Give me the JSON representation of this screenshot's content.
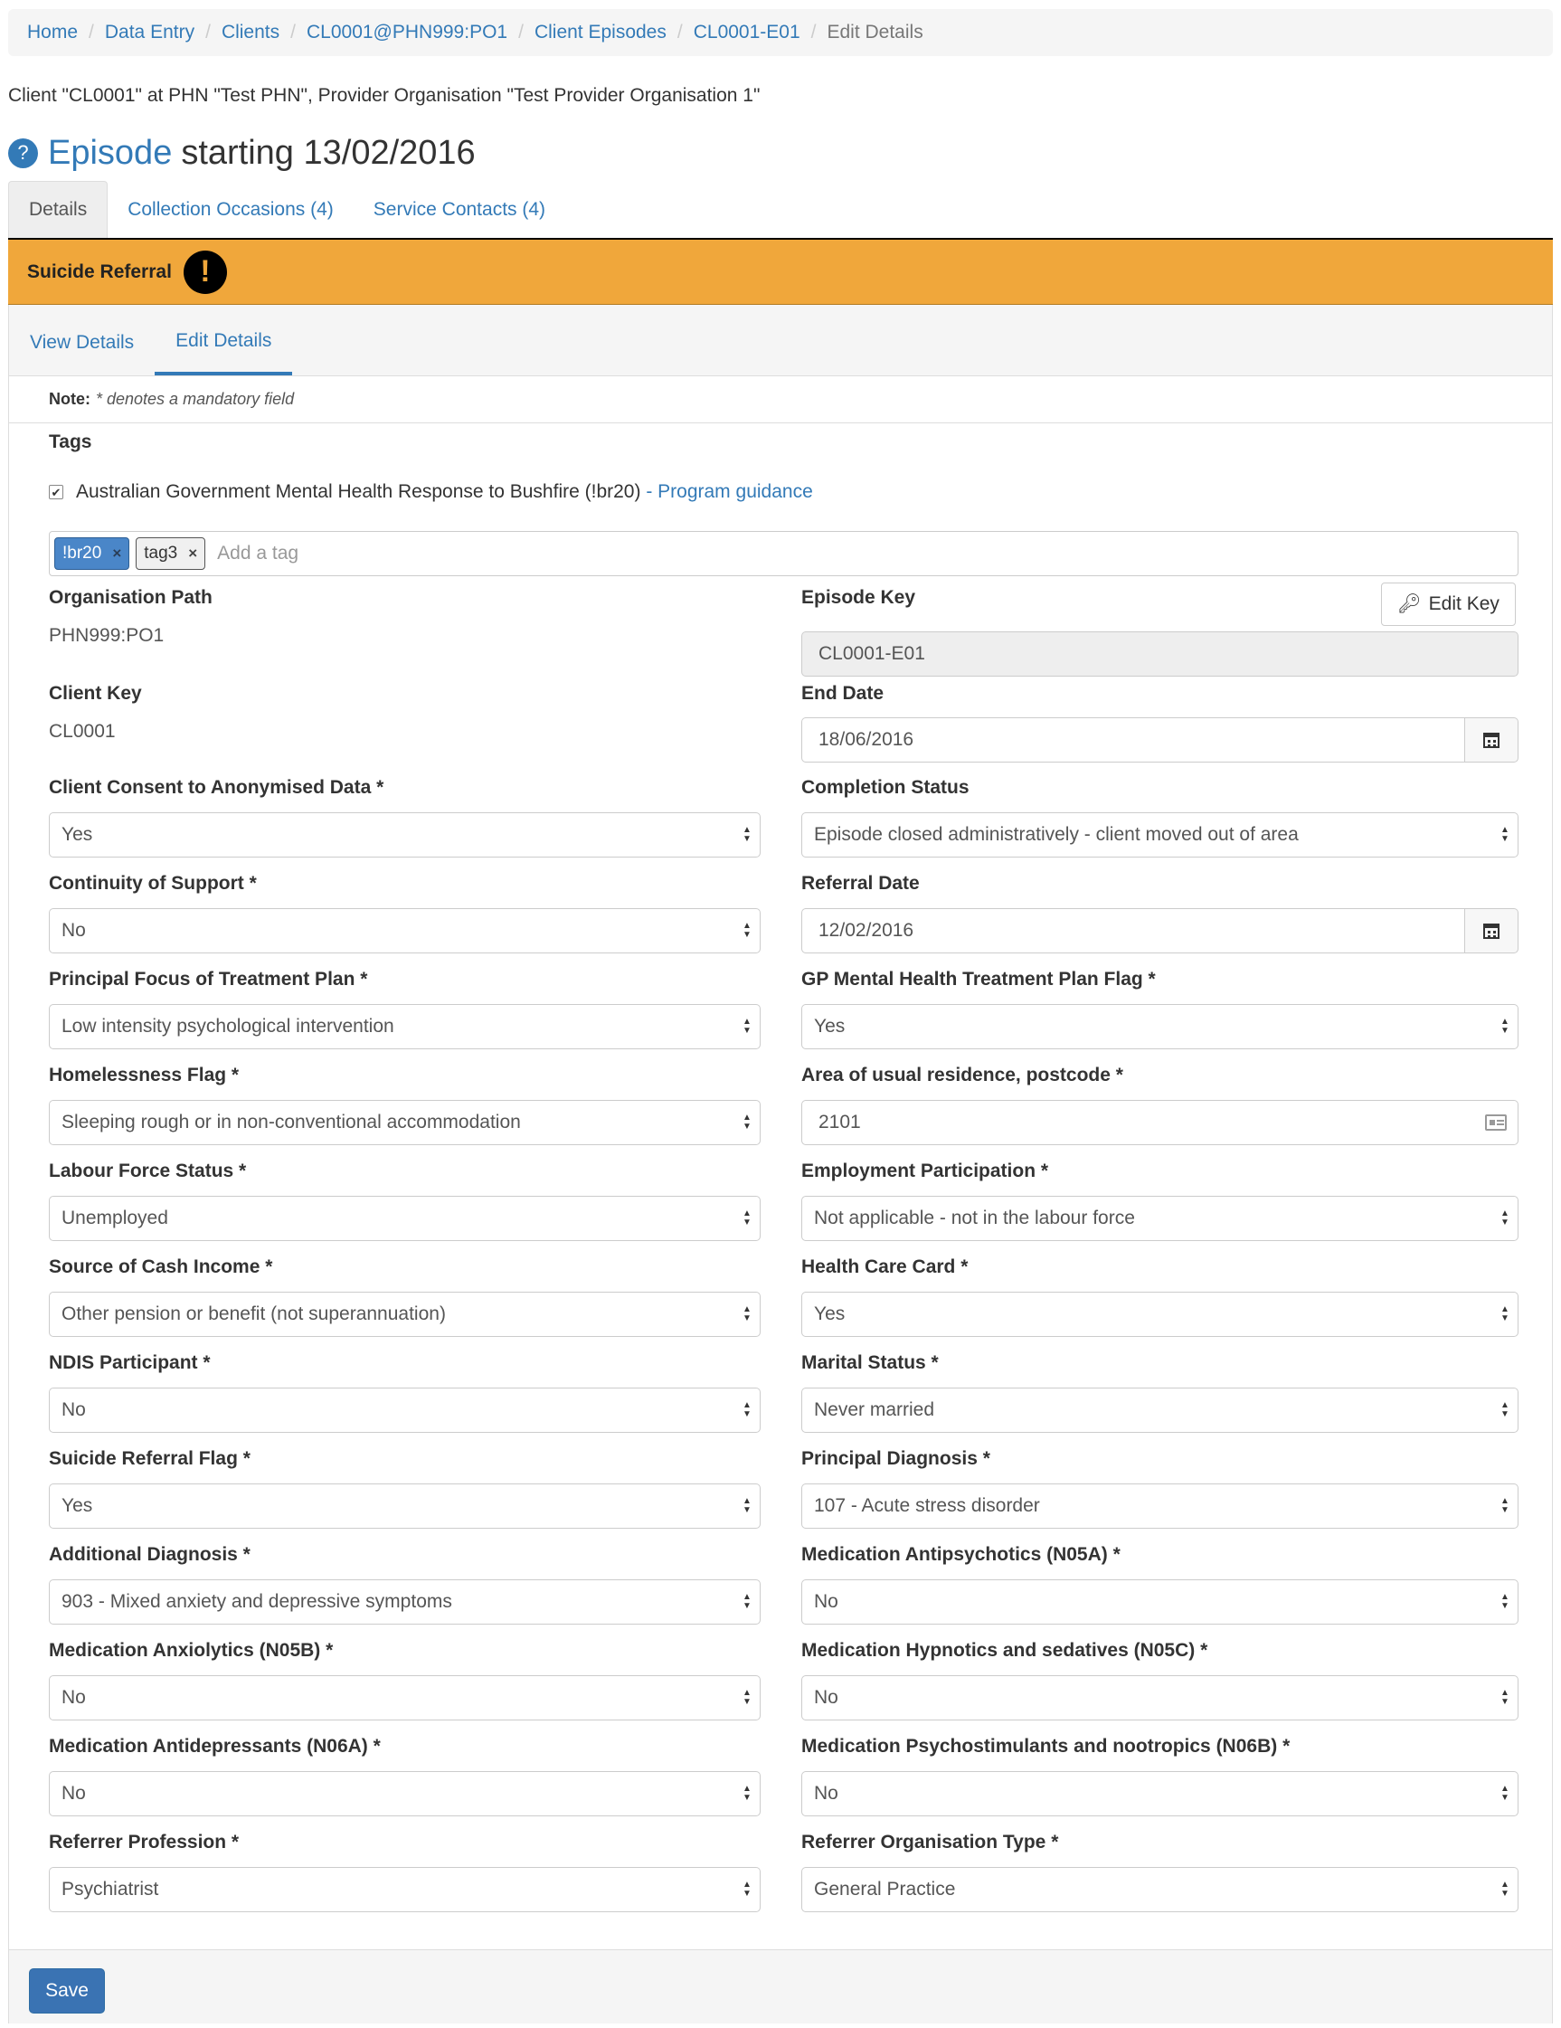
{
  "breadcrumb": {
    "items": [
      "Home",
      "Data Entry",
      "Clients",
      "CL0001@PHN999:PO1",
      "Client Episodes",
      "CL0001-E01"
    ],
    "current": "Edit Details"
  },
  "context_line": "Client \"CL0001\" at PHN \"Test PHN\", Provider Organisation \"Test Provider Organisation 1\"",
  "title": {
    "help_icon": "?",
    "episode_word": "Episode",
    "rest": "starting 13/02/2016"
  },
  "main_tabs": [
    "Details",
    "Collection Occasions (4)",
    "Service Contacts (4)"
  ],
  "alert": {
    "label": "Suicide Referral",
    "icon": "!"
  },
  "sub_tabs": [
    "View Details",
    "Edit Details"
  ],
  "note": {
    "label": "Note:",
    "text": "* denotes a mandatory field"
  },
  "tags": {
    "label": "Tags",
    "checkbox_text": "Australian Government Mental Health Response to Bushfire (!br20)",
    "link_sep": " - ",
    "link_text": "Program guidance",
    "chips": [
      "!br20",
      "tag3"
    ],
    "chip_close": "×",
    "placeholder": "Add a tag"
  },
  "left": {
    "organisation_path": {
      "label": "Organisation Path",
      "value": "PHN999:PO1"
    },
    "client_key": {
      "label": "Client Key",
      "value": "CL0001"
    },
    "selects": [
      {
        "label": "Client Consent to Anonymised Data *",
        "value": "Yes"
      },
      {
        "label": "Continuity of Support *",
        "value": "No"
      },
      {
        "label": "Principal Focus of Treatment Plan *",
        "value": "Low intensity psychological intervention"
      },
      {
        "label": "Homelessness Flag *",
        "value": "Sleeping rough or in non-conventional accommodation"
      },
      {
        "label": "Labour Force Status *",
        "value": "Unemployed"
      },
      {
        "label": "Source of Cash Income *",
        "value": "Other pension or benefit (not superannuation)"
      },
      {
        "label": "NDIS Participant *",
        "value": "No"
      },
      {
        "label": "Suicide Referral Flag *",
        "value": "Yes"
      },
      {
        "label": "Additional Diagnosis *",
        "value": "903 - Mixed anxiety and depressive symptoms"
      },
      {
        "label": "Medication Anxiolytics (N05B) *",
        "value": "No"
      },
      {
        "label": "Medication Antidepressants (N06A) *",
        "value": "No"
      },
      {
        "label": "Referrer Profession *",
        "value": "Psychiatrist"
      }
    ]
  },
  "right": {
    "episode_key": {
      "label": "Episode Key",
      "value": "CL0001-E01",
      "button": "Edit Key"
    },
    "end_date": {
      "label": "End Date",
      "value": "18/06/2016"
    },
    "completion_status": {
      "label": "Completion Status",
      "value": "Episode closed administratively - client moved out of area"
    },
    "referral_date": {
      "label": "Referral Date",
      "value": "12/02/2016"
    },
    "gp_flag": {
      "label": "GP Mental Health Treatment Plan Flag *",
      "value": "Yes"
    },
    "postcode": {
      "label": "Area of usual residence, postcode *",
      "value": "2101"
    },
    "selects": [
      {
        "label": "Employment Participation *",
        "value": "Not applicable - not in the labour force"
      },
      {
        "label": "Health Care Card *",
        "value": "Yes"
      },
      {
        "label": "Marital Status *",
        "value": "Never married"
      },
      {
        "label": "Principal Diagnosis *",
        "value": "107 - Acute stress disorder"
      },
      {
        "label": "Medication Antipsychotics (N05A) *",
        "value": "No"
      },
      {
        "label": "Medication Hypnotics and sedatives (N05C) *",
        "value": "No"
      },
      {
        "label": "Medication Psychostimulants and nootropics (N06B) *",
        "value": "No"
      },
      {
        "label": "Referrer Organisation Type *",
        "value": "General Practice"
      }
    ]
  },
  "footer": {
    "save_label": "Save"
  },
  "colors": {
    "link": "#337ab7",
    "alert": "#f0a73b",
    "save": "#3a73b3"
  }
}
